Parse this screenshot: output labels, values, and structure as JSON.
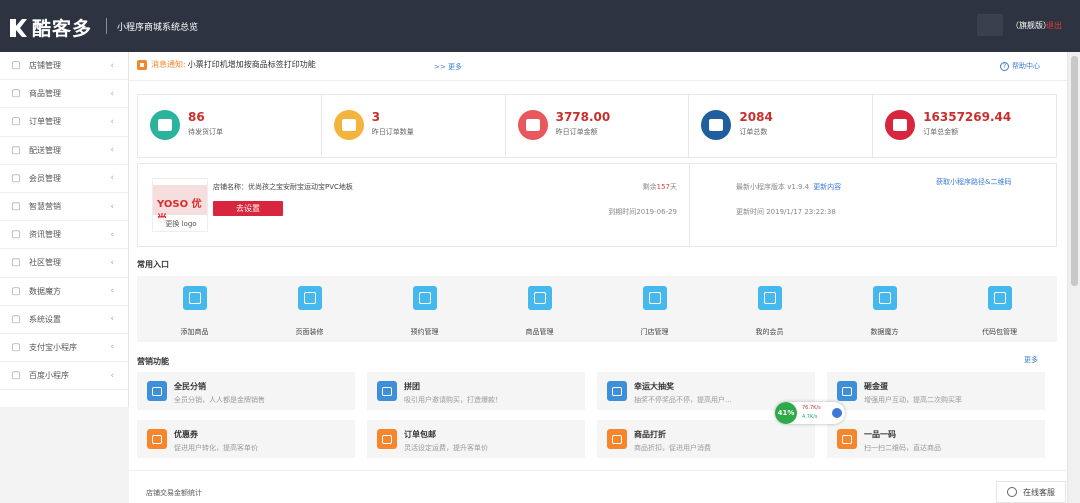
{
  "topbar": {
    "brand": "酷客多",
    "system": "小程序商城系统",
    "overview": "总览",
    "edition": "（旗舰版）",
    "logout": "退出"
  },
  "sidebar": {
    "items": [
      {
        "label": "店铺管理",
        "icon": "store-icon"
      },
      {
        "label": "商品管理",
        "icon": "goods-icon"
      },
      {
        "label": "订单管理",
        "icon": "order-icon"
      },
      {
        "label": "配送管理",
        "icon": "delivery-icon"
      },
      {
        "label": "会员管理",
        "icon": "member-icon"
      },
      {
        "label": "智慧营销",
        "icon": "marketing-icon"
      },
      {
        "label": "资讯管理",
        "icon": "news-icon"
      },
      {
        "label": "社区管理",
        "icon": "community-icon"
      },
      {
        "label": "数据魔方",
        "icon": "data-icon"
      },
      {
        "label": "系统设置",
        "icon": "settings-icon"
      },
      {
        "label": "支付宝小程序",
        "icon": "alipay-icon"
      },
      {
        "label": "百度小程序",
        "icon": "baidu-icon"
      }
    ]
  },
  "notice": {
    "label": "消息通知:",
    "text": "小票打印机增加按商品标签打印功能",
    "more": ">> 更多",
    "help": "帮助中心"
  },
  "stats": [
    {
      "value": "86",
      "label": "待发货订单",
      "color": "#2bb39b"
    },
    {
      "value": "3",
      "label": "昨日订单数量",
      "color": "#f2b43c"
    },
    {
      "value": "3778.00",
      "label": "昨日订单金额",
      "color": "#e8585c"
    },
    {
      "value": "2084",
      "label": "订单总数",
      "color": "#1f5f9e"
    },
    {
      "value": "16357269.44",
      "label": "订单总金额",
      "color": "#d7263d"
    }
  ],
  "shop": {
    "logo_brand": "YOSO 优尚",
    "logo_caption": "更换 logo",
    "name": "店铺名称：优尚孩之宝安耐宝运动宝PVC地板",
    "setup_button": "去设置",
    "remain_prefix": "剩余",
    "remain_days": "157",
    "remain_suffix": "天",
    "expire": "到期时间2019-06-29",
    "version": "最新小程序版本 v1.9.4",
    "update_link": "更新内容",
    "qr_link": "获取小程序路径&二维码",
    "updated": "更新时间 2019/1/17 23:22:38"
  },
  "quick": {
    "title": "常用入口",
    "items": [
      {
        "label": "添加商品",
        "icon": "add-goods-icon"
      },
      {
        "label": "页面装修",
        "icon": "decorate-icon"
      },
      {
        "label": "预约管理",
        "icon": "appointment-icon"
      },
      {
        "label": "商品管理",
        "icon": "goods-manage-icon"
      },
      {
        "label": "门店管理",
        "icon": "shop-manage-icon"
      },
      {
        "label": "我的会员",
        "icon": "my-member-icon"
      },
      {
        "label": "数据魔方",
        "icon": "data-cube-icon"
      },
      {
        "label": "代码包管理",
        "icon": "code-package-icon"
      }
    ]
  },
  "marketing": {
    "title": "营销功能",
    "more": "更多",
    "items": [
      {
        "title": "全民分销",
        "desc": "全员分销，人人都是金牌销售",
        "color": "#3d8fd9",
        "icon": "distribution-icon"
      },
      {
        "title": "拼团",
        "desc": "吸引用户邀请购买，打造爆款！",
        "color": "#3d8fd9",
        "icon": "group-buy-icon"
      },
      {
        "title": "幸运大抽奖",
        "desc": "抽奖不停奖品不停，提高用户...",
        "color": "#3d8fd9",
        "icon": "lottery-icon"
      },
      {
        "title": "砸金蛋",
        "desc": "增强用户互动，提高二次购买率",
        "color": "#3d8fd9",
        "icon": "golden-egg-icon"
      },
      {
        "title": "优惠券",
        "desc": "促进用户转化，提高客单价",
        "color": "#f5862b",
        "icon": "coupon-icon"
      },
      {
        "title": "订单包邮",
        "desc": "灵活设定运费，提升客单价",
        "color": "#f5862b",
        "icon": "free-shipping-icon"
      },
      {
        "title": "商品打折",
        "desc": "商品折扣，促进用户消费",
        "color": "#f5862b",
        "icon": "discount-icon"
      },
      {
        "title": "一品一码",
        "desc": "扫一扫二维码，直达商品",
        "color": "#f5862b",
        "icon": "qrcode-icon"
      }
    ]
  },
  "footer": {
    "stat_title": "店铺交易金额统计",
    "chat": "在线客服"
  },
  "network": {
    "percent": "41%",
    "up": "76.7K/s",
    "down": "4.7K/s"
  }
}
